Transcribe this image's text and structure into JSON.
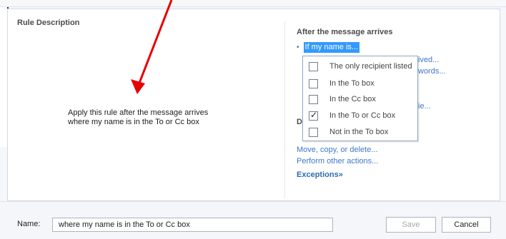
{
  "left": {
    "title": "Rule Description",
    "description_lines": [
      "Apply this rule after the message arrives",
      "where my name is in the To or Cc box"
    ]
  },
  "right": {
    "after_title": "After the message arrives",
    "selected_condition": "If my name is...",
    "hidden_links": [
      "ived...",
      "words...",
      "ie..."
    ],
    "do_title": "Do",
    "actions": [
      "Move, copy, or delete...",
      "Perform other actions..."
    ],
    "exceptions_label": "Exceptions",
    "exceptions_icon": "double-chevron-down-icon"
  },
  "dropdown": {
    "options": [
      {
        "label": "The only recipient listed",
        "checked": false
      },
      {
        "label": "In the To box",
        "checked": false
      },
      {
        "label": "In the Cc box",
        "checked": false
      },
      {
        "label": "In the To or Cc box",
        "checked": true
      },
      {
        "label": "Not in the To box",
        "checked": false
      }
    ]
  },
  "footer": {
    "name_label": "Name:",
    "name_value": "where my name is in the To or Cc box",
    "save_label": "Save",
    "cancel_label": "Cancel"
  },
  "colors": {
    "link": "#3c78c8",
    "selection": "#3399ff",
    "arrow": "#e60000"
  }
}
